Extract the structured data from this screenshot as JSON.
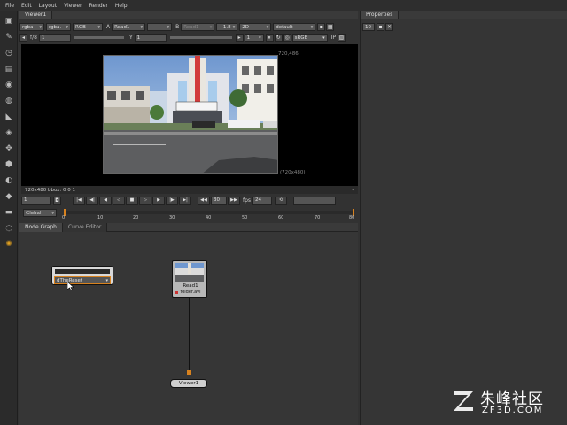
{
  "menubar": {
    "items": [
      "File",
      "Edit",
      "Layout",
      "Viewer",
      "Render",
      "Help"
    ]
  },
  "viewer": {
    "tab_label": "Viewer1",
    "channels": "rgba",
    "channels_alpha": "rgba.",
    "display": "RGB",
    "input_a_label": "A",
    "input_a": "Read1",
    "input_a_op": "-",
    "input_b_label": "B",
    "input_b": "Read1",
    "gain": "+1.8",
    "view_mode": "2D",
    "lut": "default",
    "fstop_label": "f/8",
    "fstop_value": "1",
    "gamma_label": "Y",
    "gamma_value": "1",
    "proxy": "1",
    "colorspace": "sRGB",
    "ip_label": "IP",
    "format_top": "720,486",
    "format_bottom": "(720x480)",
    "info_text": "720x480 bbox: 0 0 1",
    "frame_current": "1",
    "fps_value": "30",
    "fps_label": "fps",
    "fps_field": "24",
    "range_mode": "Global",
    "timeline_ticks": [
      "0",
      "10",
      "20",
      "30",
      "40",
      "50",
      "60",
      "70",
      "80"
    ]
  },
  "node_graph": {
    "tabs": [
      "Node Graph",
      "Curve Editor"
    ],
    "nodes": {
      "dropdown_node_value": "dTheReset",
      "read_node_label": "Read1",
      "read_node_file": "folder.avi",
      "viewer_node_label": "Viewer1"
    }
  },
  "properties": {
    "tab_label": "Properties",
    "max_panels": "10"
  },
  "watermark": {
    "text": "朱峰社区",
    "url": "ZF3D.COM"
  },
  "colors": {
    "accent_orange": "#d8821e",
    "node_read": "#b8b8b8",
    "node_viewer": "#cfcfcf"
  }
}
